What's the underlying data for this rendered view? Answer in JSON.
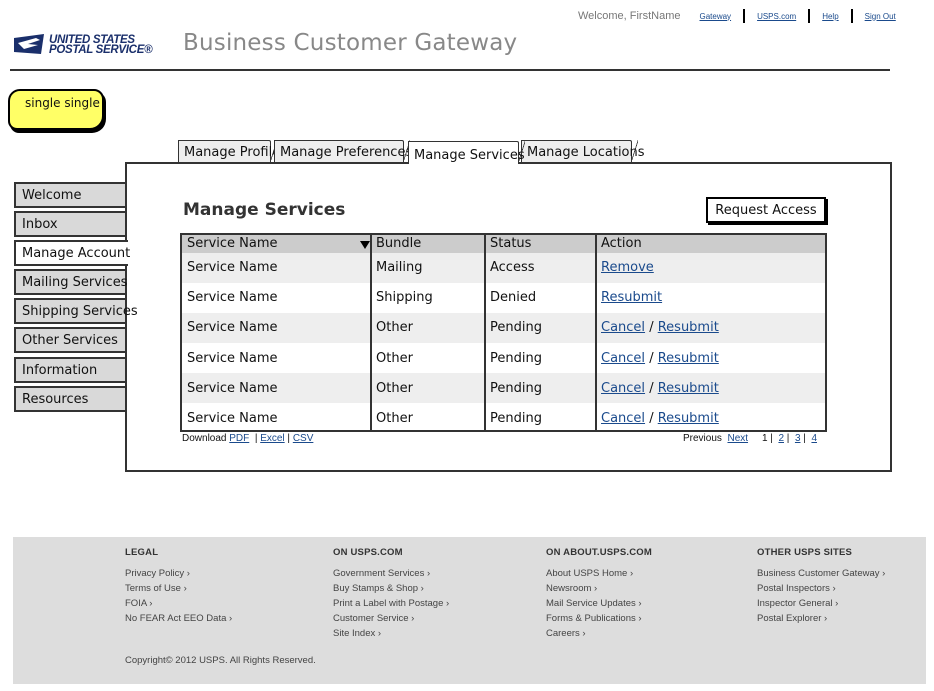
{
  "header": {
    "welcome": "Welcome, FirstName",
    "links": [
      "Gateway",
      "USPS.com",
      "Help",
      "Sign Out"
    ],
    "logo_line1": "UNITED STATES",
    "logo_line2": "POSTAL SERVICE",
    "logo_mark": "®",
    "app_title": "Business Customer Gateway"
  },
  "sticky_note": "single single",
  "tabs": [
    "Manage Profile",
    "Manage Preferences",
    "Manage Services",
    "Manage Locations"
  ],
  "active_tab": "Manage Services",
  "sidebar": [
    "Welcome",
    "Inbox",
    "Manage Account",
    "Mailing Services",
    "Shipping Services",
    "Other Services",
    "Information",
    "Resources"
  ],
  "active_sidebar": "Manage Account",
  "main": {
    "title": "Manage Services",
    "request_button": "Request Access",
    "columns": [
      "Service Name",
      "Bundle",
      "Status",
      "Action"
    ],
    "rows": [
      {
        "service": "Service Name",
        "bundle": "Mailing",
        "status": "Access",
        "action1": "Remove",
        "action2": ""
      },
      {
        "service": "Service Name",
        "bundle": "Shipping",
        "status": "Denied",
        "action1": "Resubmit",
        "action2": ""
      },
      {
        "service": "Service Name",
        "bundle": "Other",
        "status": "Pending",
        "action1": "Cancel",
        "action2": "Resubmit"
      },
      {
        "service": "Service Name",
        "bundle": "Other",
        "status": "Pending",
        "action1": "Cancel",
        "action2": "Resubmit"
      },
      {
        "service": "Service Name",
        "bundle": "Other",
        "status": "Pending",
        "action1": "Cancel",
        "action2": "Resubmit"
      },
      {
        "service": "Service Name",
        "bundle": "Other",
        "status": "Pending",
        "action1": "Cancel",
        "action2": "Resubmit"
      }
    ],
    "action_separator": "/",
    "download": {
      "label": "Download",
      "pdf": "PDF",
      "excel": "Excel",
      "csv": "CSV"
    },
    "pagination": {
      "previous": "Previous",
      "next": "Next",
      "pages": [
        "1",
        "2",
        "3",
        "4"
      ],
      "current": "1"
    }
  },
  "footer": {
    "columns": [
      {
        "heading": "LEGAL",
        "links": [
          "Privacy Policy ›",
          "Terms of Use ›",
          "FOIA ›",
          "No FEAR Act EEO Data ›"
        ]
      },
      {
        "heading": "ON USPS.COM",
        "links": [
          "Government Services ›",
          "Buy Stamps & Shop ›",
          "Print a Label with Postage ›",
          "Customer Service ›",
          "Site Index ›"
        ]
      },
      {
        "heading": "ON ABOUT.USPS.COM",
        "links": [
          "About USPS Home ›",
          "Newsroom ›",
          "Mail Service Updates ›",
          "Forms & Publications ›",
          "Careers ›"
        ]
      },
      {
        "heading": "OTHER USPS SITES",
        "links": [
          "Business Customer Gateway ›",
          "Postal Inspectors ›",
          "Inspector General ›",
          "Postal Explorer ›"
        ]
      }
    ],
    "copyright": "Copyright© 2012 USPS. All Rights Reserved."
  },
  "colors": {
    "link": "#1a4a8c",
    "sticky": "#ffff66",
    "header_row": "#cccccc",
    "footer_bg": "#dddddd",
    "nav_bg": "#d9d9d9"
  }
}
